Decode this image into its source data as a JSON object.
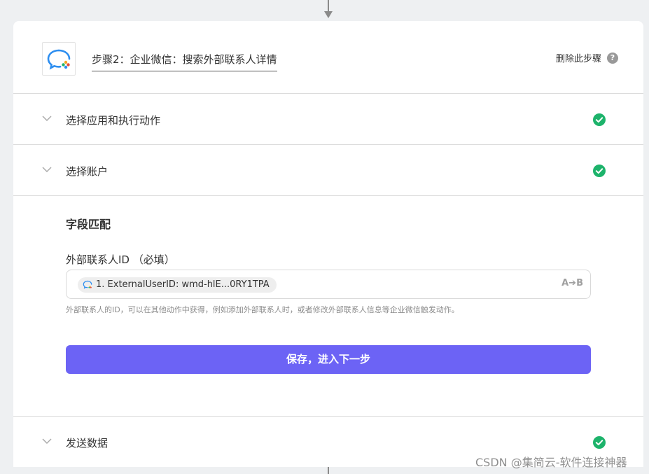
{
  "step": {
    "title": "步骤2：企业微信：搜索外部联系人详情",
    "delete_label": "删除此步骤",
    "help_glyph": "?",
    "app_icon": "wecom-logo-icon"
  },
  "sections": [
    {
      "label": "选择应用和执行动作",
      "status": "complete"
    },
    {
      "label": "选择账户",
      "status": "complete"
    }
  ],
  "field_mapping": {
    "heading": "字段匹配",
    "field_label": "外部联系人ID （必填）",
    "token_text": "1. ExternalUserID: wmd-hlE...0RY1TPA",
    "transform_icon": "A➔B",
    "hint": "外部联系人的ID，可以在其他动作中获得，例如添加外部联系人时，或者修改外部联系人信息等企业微信触发动作。",
    "save_button": "保存，进入下一步"
  },
  "bottom_section": {
    "label": "发送数据",
    "status": "complete"
  },
  "watermark": "CSDN @集简云-软件连接神器",
  "colors": {
    "primary": "#6c63f5",
    "success": "#1db36b",
    "background": "#eef0f2"
  }
}
